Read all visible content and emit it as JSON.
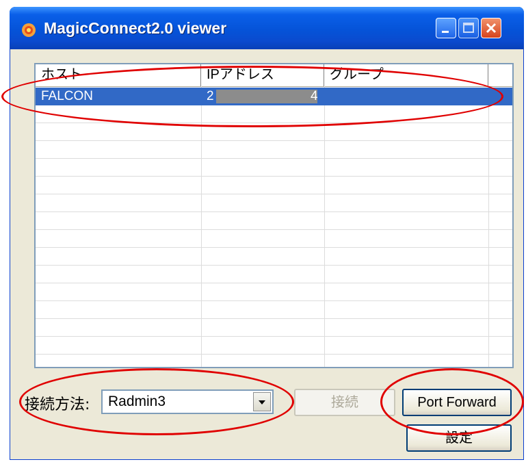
{
  "window": {
    "title": "MagicConnect2.0 viewer"
  },
  "list": {
    "columns": [
      "ホスト",
      "IPアドレス",
      "グループ"
    ],
    "rows": [
      {
        "host": "FALCON",
        "ip_start": "2",
        "ip_end": "4",
        "group": ""
      }
    ]
  },
  "controls": {
    "connect_method_label": "接続方法:",
    "connect_method_value": "Radmin3",
    "connect_button": "接続",
    "port_forward_button": "Port Forward",
    "settings_button": "設定"
  },
  "colors": {
    "selection": "#3169c6",
    "annotation": "#e00000",
    "title_bar": "#0553d8"
  }
}
